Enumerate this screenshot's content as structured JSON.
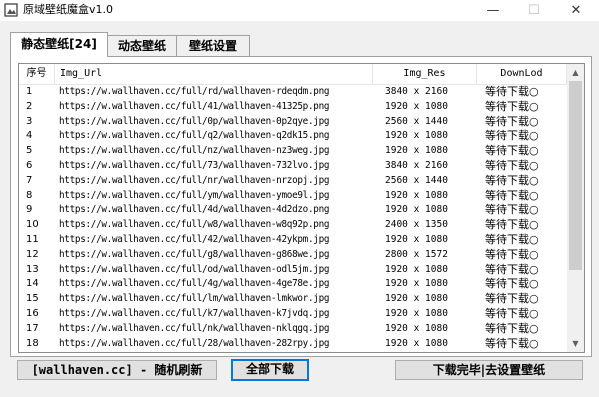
{
  "window": {
    "title": "原域壁纸魔盒v1.0",
    "controls": {
      "minimize": "—",
      "maximize": "☐",
      "close": "✕"
    }
  },
  "tabs": [
    {
      "label": "静态壁纸[24]",
      "active": true
    },
    {
      "label": "动态壁纸",
      "active": false
    },
    {
      "label": "壁纸设置",
      "active": false
    }
  ],
  "table": {
    "columns": [
      "序号",
      "Img_Url",
      "Img_Res",
      "DownLod"
    ],
    "rows": [
      [
        "1",
        "https://w.wallhaven.cc/full/rd/wallhaven-rdeqdm.png",
        "3840 x 2160",
        "等待下载○"
      ],
      [
        "2",
        "https://w.wallhaven.cc/full/41/wallhaven-41325p.png",
        "1920 x 1080",
        "等待下载○"
      ],
      [
        "3",
        "https://w.wallhaven.cc/full/0p/wallhaven-0p2qye.jpg",
        "2560 x 1440",
        "等待下载○"
      ],
      [
        "4",
        "https://w.wallhaven.cc/full/q2/wallhaven-q2dk15.png",
        "1920 x 1080",
        "等待下载○"
      ],
      [
        "5",
        "https://w.wallhaven.cc/full/nz/wallhaven-nz3weg.jpg",
        "1920 x 1080",
        "等待下载○"
      ],
      [
        "6",
        "https://w.wallhaven.cc/full/73/wallhaven-732lvo.jpg",
        "3840 x 2160",
        "等待下载○"
      ],
      [
        "7",
        "https://w.wallhaven.cc/full/nr/wallhaven-nrzopj.jpg",
        "2560 x 1440",
        "等待下载○"
      ],
      [
        "8",
        "https://w.wallhaven.cc/full/ym/wallhaven-ymoe9l.jpg",
        "1920 x 1080",
        "等待下载○"
      ],
      [
        "9",
        "https://w.wallhaven.cc/full/4d/wallhaven-4d2dzo.png",
        "1920 x 1080",
        "等待下载○"
      ],
      [
        "10",
        "https://w.wallhaven.cc/full/w8/wallhaven-w8q92p.png",
        "2400 x 1350",
        "等待下载○"
      ],
      [
        "11",
        "https://w.wallhaven.cc/full/42/wallhaven-42ykpm.jpg",
        "1920 x 1080",
        "等待下载○"
      ],
      [
        "12",
        "https://w.wallhaven.cc/full/g8/wallhaven-g868we.jpg",
        "2800 x 1572",
        "等待下载○"
      ],
      [
        "13",
        "https://w.wallhaven.cc/full/od/wallhaven-odl5jm.jpg",
        "1920 x 1080",
        "等待下载○"
      ],
      [
        "14",
        "https://w.wallhaven.cc/full/4g/wallhaven-4ge78e.jpg",
        "1920 x 1080",
        "等待下载○"
      ],
      [
        "15",
        "https://w.wallhaven.cc/full/lm/wallhaven-lmkwor.jpg",
        "1920 x 1080",
        "等待下载○"
      ],
      [
        "16",
        "https://w.wallhaven.cc/full/k7/wallhaven-k7jvdq.jpg",
        "1920 x 1080",
        "等待下载○"
      ],
      [
        "17",
        "https://w.wallhaven.cc/full/nk/wallhaven-nklqgq.jpg",
        "1920 x 1080",
        "等待下载○"
      ],
      [
        "18",
        "https://w.wallhaven.cc/full/28/wallhaven-282rpy.jpg",
        "1920 x 1080",
        "等待下载○"
      ]
    ]
  },
  "scrollbar": {
    "up_icon": "▲",
    "down_icon": "▼"
  },
  "buttons": {
    "refresh": "[wallhaven.cc] - 随机刷新",
    "download_all": "全部下载",
    "set_wallpaper": "下载完毕|去设置壁纸"
  },
  "colors": {
    "focus_border": "#0078d7",
    "window_bg": "#f0f0f0",
    "scroll_thumb": "#cdcdcd"
  }
}
